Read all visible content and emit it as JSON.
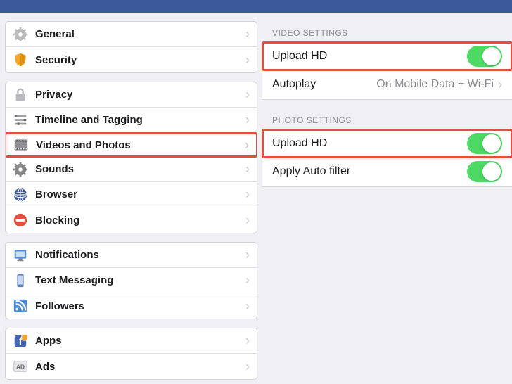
{
  "leftPane": {
    "groups": [
      {
        "items": [
          {
            "key": "general",
            "label": "General",
            "icon": "gear"
          },
          {
            "key": "security",
            "label": "Security",
            "icon": "shield"
          }
        ]
      },
      {
        "items": [
          {
            "key": "privacy",
            "label": "Privacy",
            "icon": "lock"
          },
          {
            "key": "timeline",
            "label": "Timeline and Tagging",
            "icon": "timeline"
          },
          {
            "key": "videos",
            "label": "Videos and Photos",
            "icon": "film",
            "highlighted": true
          },
          {
            "key": "sounds",
            "label": "Sounds",
            "icon": "gear2"
          },
          {
            "key": "browser",
            "label": "Browser",
            "icon": "globe"
          },
          {
            "key": "blocking",
            "label": "Blocking",
            "icon": "block"
          }
        ]
      },
      {
        "items": [
          {
            "key": "notifications",
            "label": "Notifications",
            "icon": "monitor"
          },
          {
            "key": "text",
            "label": "Text Messaging",
            "icon": "phone"
          },
          {
            "key": "followers",
            "label": "Followers",
            "icon": "rss"
          }
        ]
      },
      {
        "items": [
          {
            "key": "apps",
            "label": "Apps",
            "icon": "apps"
          },
          {
            "key": "ads",
            "label": "Ads",
            "icon": "ads"
          }
        ]
      }
    ]
  },
  "rightPane": {
    "sections": [
      {
        "header": "VIDEO SETTINGS",
        "rows": [
          {
            "key": "video_hd",
            "label": "Upload HD",
            "type": "toggle",
            "on": true,
            "highlighted": true
          },
          {
            "key": "autoplay",
            "label": "Autoplay",
            "type": "link",
            "value": "On Mobile Data + Wi-Fi"
          }
        ]
      },
      {
        "header": "PHOTO SETTINGS",
        "rows": [
          {
            "key": "photo_hd",
            "label": "Upload HD",
            "type": "toggle",
            "on": true,
            "highlighted": true
          },
          {
            "key": "autofilter",
            "label": "Apply Auto filter",
            "type": "toggle",
            "on": true
          }
        ]
      }
    ]
  }
}
